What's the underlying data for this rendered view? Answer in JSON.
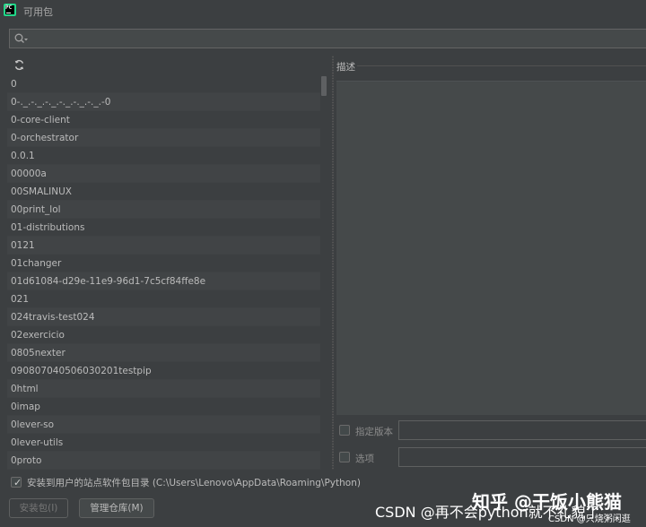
{
  "window": {
    "title": "可用包",
    "app_icon": "pycharm-icon",
    "app_icon_text": "PC"
  },
  "search": {
    "value": "",
    "placeholder": ""
  },
  "toolbar": {
    "refresh_icon": "refresh-icon"
  },
  "packages": [
    "0",
    "0-._.-._.-._.-._.-._.-._.-0",
    "0-core-client",
    "0-orchestrator",
    "0.0.1",
    "00000a",
    "00SMALINUX",
    "00print_lol",
    "01-distributions",
    "0121",
    "01changer",
    "01d61084-d29e-11e9-96d1-7c5cf84ffe8e",
    "021",
    "024travis-test024",
    "02exercicio",
    "0805nexter",
    "090807040506030201testpip",
    "0html",
    "0imap",
    "0lever-so",
    "0lever-utils",
    "0proto"
  ],
  "description": {
    "label": "描述",
    "content": ""
  },
  "options": {
    "specify_version_label": "指定版本",
    "specify_version_value": "",
    "options_label": "选项",
    "options_value": ""
  },
  "install_to_user": {
    "checked": true,
    "label": "安装到用户的站点软件包目录 (C:\\Users\\Lenovo\\AppData\\Roaming\\Python)"
  },
  "buttons": {
    "install": "安装包(I)",
    "manage_repos": "管理仓库(M)"
  },
  "watermarks": {
    "csdn": "CSDN @再不会python就不礼貌了",
    "zhihu": "知乎 @干饭小熊猫",
    "csdn_small": "CSDN @只烧粥闲逛"
  }
}
